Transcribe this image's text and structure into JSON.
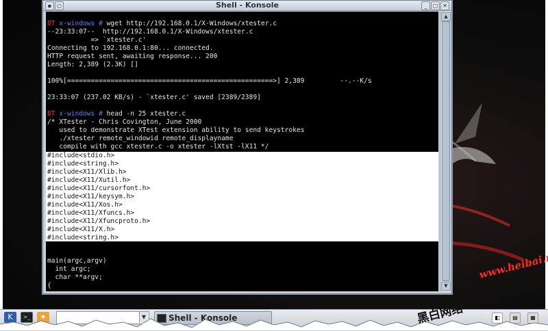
{
  "window": {
    "title": "Shell - Konsole",
    "buttons": [
      "_",
      "□",
      "✕"
    ]
  },
  "terminal": {
    "lines_top": [
      {
        "prompt_bt": "BT",
        "prompt_host": " x-windows #",
        "text": " wget http://192.168.0.1/X-Windows/xtester.c"
      },
      {
        "text": "--23:33:07--  http://192.168.0.1/X-Windows/xtester.c"
      },
      {
        "text": "           => `xtester.c'"
      },
      {
        "text": "Connecting to 192.168.0.1:80... connected."
      },
      {
        "text": "HTTP request sent, awaiting response... 200"
      },
      {
        "text": "Length: 2,389 (2.3K) []"
      },
      {
        "text": ""
      },
      {
        "text": "100%[====================================================>] 2,389         --.--K/s"
      },
      {
        "text": ""
      },
      {
        "text": "23:33:07 (237.02 KB/s) - `xtester.c' saved [2389/2389]"
      },
      {
        "text": ""
      },
      {
        "prompt_bt": "BT",
        "prompt_host": " x-windows #",
        "text": " head -n 25 xtester.c"
      },
      {
        "text": "/* XTester - Chris Covington, June 2000"
      },
      {
        "text": "   used to demonstrate XTest extension ability to send keystrokes"
      },
      {
        "text": "   ./xtester remote_windowid remote_displayname"
      },
      {
        "text": "   compile with gcc xtester.c -o xtester -lXtst -lX11 */"
      }
    ],
    "selected_lines": [
      "#include<stdio.h>",
      "#include<string.h>",
      "#include<X11/Xlib.h>",
      "#include<X11/Xutil.h>",
      "#include<X11/cursorfont.h>",
      "#include<X11/keysym.h>",
      "#include<X11/Xos.h>",
      "#include<X11/Xfuncs.h>",
      "#include<X11/Xfuncproto.h>",
      "#include<X11/X.h>",
      "#include<string.h>"
    ],
    "lines_bottom": [
      "",
      "",
      "main(argc,argv)",
      "  int argc;",
      "  char **argv;",
      "{"
    ]
  },
  "taskbar": {
    "task_label": "Shell - Konsole",
    "icons": [
      "kmenu-icon",
      "terminal-icon",
      "browser-icon"
    ]
  },
  "watermark": {
    "url": "www.heibai.ne",
    "chinese": "黑白网络"
  },
  "colors": {
    "prompt_bt": "#e0332b",
    "prompt_host": "#6a7cff",
    "terminal_bg": "#000000",
    "terminal_fg": "#e8e8e8",
    "watermark": "#ff2a1a"
  }
}
